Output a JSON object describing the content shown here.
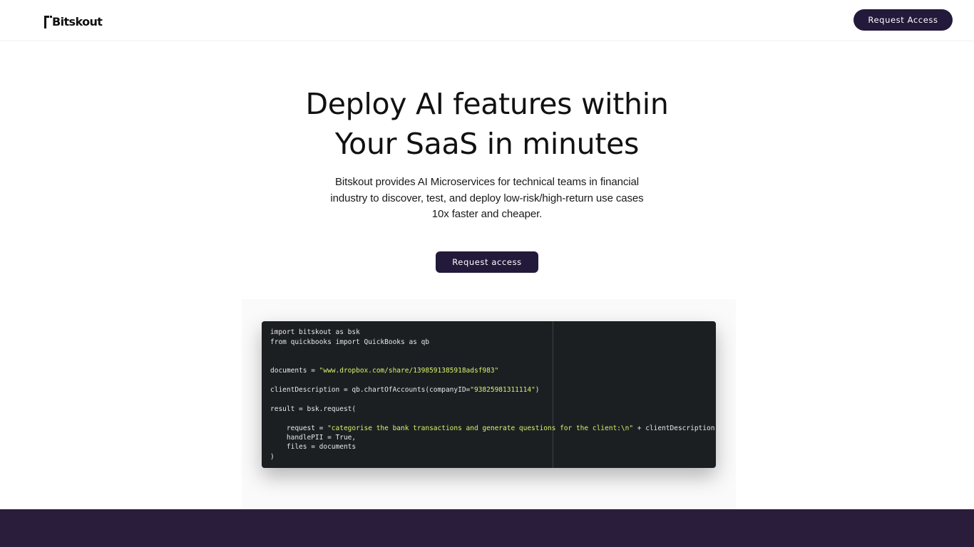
{
  "brand": {
    "logo_text": "Bitskout"
  },
  "header": {
    "request_access_label": "Request Access"
  },
  "hero": {
    "title_line1": "Deploy AI features within",
    "title_line2": "Your SaaS in minutes",
    "subtitle_line1": "Bitskout provides AI Microservices for technical teams in financial",
    "subtitle_line2": "industry to discover, test, and deploy low-risk/high-return use cases",
    "subtitle_line3": "10x faster and cheaper.",
    "cta_label": "Request access"
  },
  "code": {
    "lines": [
      {
        "pre": "import bitskout as bsk",
        "str": "",
        "post": ""
      },
      {
        "pre": "from quickbooks import QuickBooks as qb",
        "str": "",
        "post": ""
      },
      {
        "pre": "documents = ",
        "str": "\"www.dropbox.com/share/1398591385918adsf983\"",
        "post": ""
      },
      {
        "pre": "clientDescription = qb.chartOfAccounts(companyID=",
        "str": "\"93825981311114\"",
        "post": ")"
      },
      {
        "pre": "result = bsk.request(",
        "str": "",
        "post": ""
      },
      {
        "pre": "    request = ",
        "str": "\"categorise the bank transactions and generate questions for the client:\\n\"",
        "post": " + clientDescription,"
      },
      {
        "pre": "    handlePII = True,",
        "str": "",
        "post": ""
      },
      {
        "pre": "    files = documents",
        "str": "",
        "post": ""
      },
      {
        "pre": ")",
        "str": "",
        "post": ""
      }
    ]
  },
  "colors": {
    "brand_dark": "#23193a",
    "footer": "#2a1d3c",
    "code_bg": "#1c1f22",
    "code_string": "#d7f36b"
  }
}
